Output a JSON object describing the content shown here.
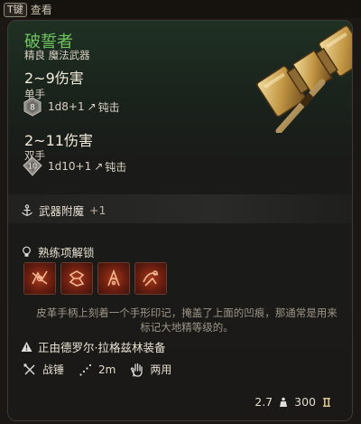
{
  "hint": {
    "key": "T键",
    "label": "查看"
  },
  "item": {
    "name": "破誓者",
    "subtype": "精良 魔法武器",
    "weapon_icon": "warhammer-icon",
    "damage_primary": {
      "range": "2~9伤害",
      "hand": "单手",
      "die_face": "8",
      "formula": "1d8+1",
      "type": "钝击"
    },
    "damage_secondary": {
      "range": "2~11伤害",
      "hand": "双手",
      "die_face": "10",
      "formula": "1d10+1",
      "type": "钝击"
    },
    "enchant": {
      "label": "武器附魔",
      "value": "+1"
    },
    "mastery": {
      "label": "熟练项解锁",
      "actions": [
        {
          "icon": "rush-attack-icon"
        },
        {
          "icon": "tenacity-icon"
        },
        {
          "icon": "prepare-icon"
        },
        {
          "icon": "topple-icon"
        }
      ]
    },
    "description": "皮革手柄上刻着一个手形印记，掩盖了上面的凹痕，那通常是用来标记大地精等级的。",
    "requirement": "正由德罗尔·拉格兹林装备",
    "properties": [
      {
        "icon": "crossed-weapons-icon",
        "label": "战锤"
      },
      {
        "icon": "range-icon",
        "label": "2m"
      },
      {
        "icon": "hand-icon",
        "label": "两用"
      }
    ],
    "weight": "2.7",
    "value": "300"
  },
  "colors": {
    "name_green": "#71c55f",
    "accent_red": "#a53a1c"
  }
}
